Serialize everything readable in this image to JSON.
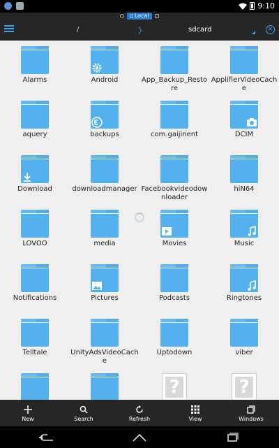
{
  "status": {
    "time": "9:10"
  },
  "topbar": {
    "local_label": "Local",
    "path_root": "/",
    "path_separator": "〉",
    "path_current": "sdcard",
    "close_glyph": "×"
  },
  "folders": [
    {
      "label": "Alarms",
      "kind": "folder",
      "badge": ""
    },
    {
      "label": "Android",
      "kind": "folder",
      "badge": "gear"
    },
    {
      "label": "App_Backup_Restore",
      "kind": "folder",
      "badge": ""
    },
    {
      "label": "ApplifierVideoCache",
      "kind": "folder",
      "badge": ""
    },
    {
      "label": "aquery",
      "kind": "folder",
      "badge": ""
    },
    {
      "label": "backups",
      "kind": "folder",
      "badge": "es"
    },
    {
      "label": "com.gaijinent",
      "kind": "folder",
      "badge": ""
    },
    {
      "label": "DCIM",
      "kind": "folder",
      "badge": "camera"
    },
    {
      "label": "Download",
      "kind": "folder",
      "badge": "download"
    },
    {
      "label": "downloadmanager",
      "kind": "folder",
      "badge": ""
    },
    {
      "label": "Facebookvideodownloader",
      "kind": "folder",
      "badge": ""
    },
    {
      "label": "hiN64",
      "kind": "folder",
      "badge": ""
    },
    {
      "label": "LOVOO",
      "kind": "folder",
      "badge": ""
    },
    {
      "label": "media",
      "kind": "folder",
      "badge": ""
    },
    {
      "label": "Movies",
      "kind": "folder",
      "badge": "play"
    },
    {
      "label": "Music",
      "kind": "folder",
      "badge": "music"
    },
    {
      "label": "Notifications",
      "kind": "folder",
      "badge": ""
    },
    {
      "label": "Pictures",
      "kind": "folder",
      "badge": "picture"
    },
    {
      "label": "Podcasts",
      "kind": "folder",
      "badge": ""
    },
    {
      "label": "Ringtones",
      "kind": "folder",
      "badge": "music"
    },
    {
      "label": "Telltale",
      "kind": "folder",
      "badge": ""
    },
    {
      "label": "UnityAdsVideoCache",
      "kind": "folder",
      "badge": ""
    },
    {
      "label": "Uptodown",
      "kind": "folder",
      "badge": ""
    },
    {
      "label": "viber",
      "kind": "folder",
      "badge": ""
    },
    {
      "label": "",
      "kind": "folder",
      "badge": ""
    },
    {
      "label": "",
      "kind": "folder",
      "badge": ""
    },
    {
      "label": "",
      "kind": "unknown",
      "badge": ""
    },
    {
      "label": "",
      "kind": "unknown",
      "badge": ""
    }
  ],
  "toolbar": {
    "new_label": "New",
    "search_label": "Search",
    "refresh_label": "Refresh",
    "view_label": "View",
    "windows_label": "Windows"
  },
  "unknown_glyph": "?"
}
